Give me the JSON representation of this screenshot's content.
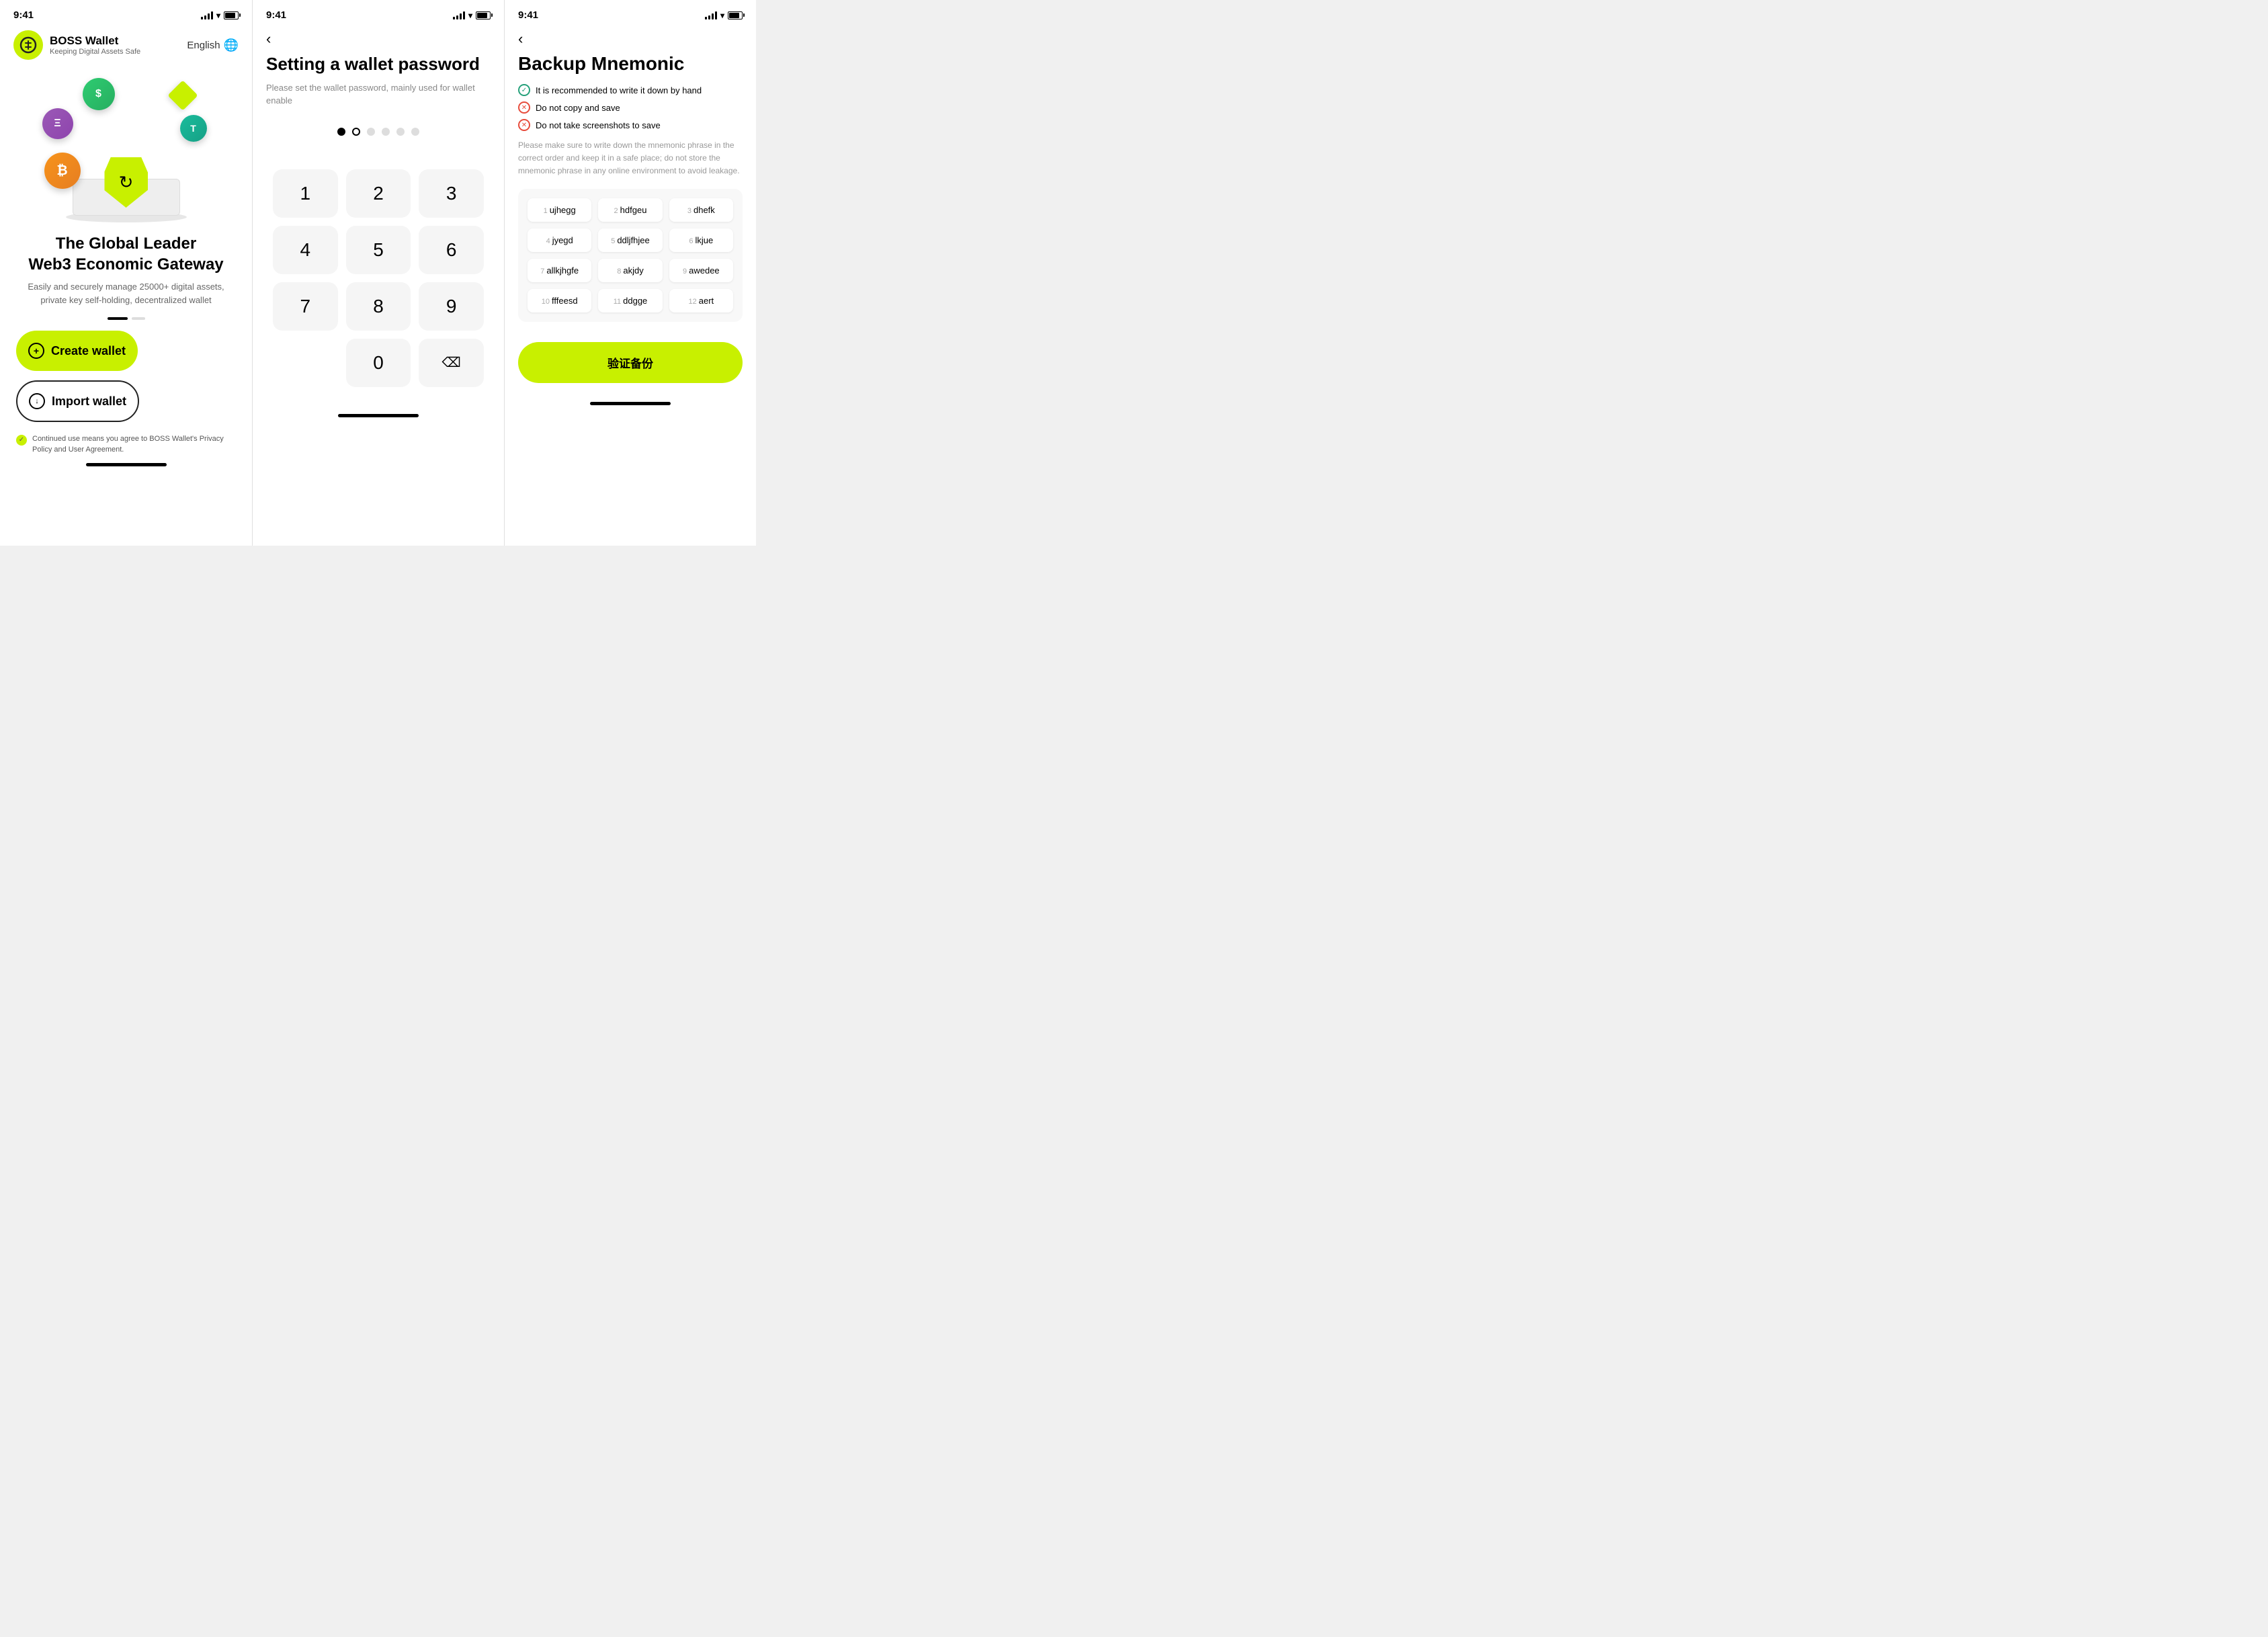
{
  "phone1": {
    "status_time": "9:41",
    "logo_emoji": "◎",
    "logo_name": "BOSS Wallet",
    "logo_tagline": "Keeping Digital Assets Safe",
    "language": "English",
    "hero_title_line1": "The Global Leader",
    "hero_title_line2": "Web3 Economic Gateway",
    "hero_subtitle": "Easily and securely manage 25000+ digital assets, private key self-holding, decentralized wallet",
    "create_label": "Create wallet",
    "import_label": "Import wallet",
    "privacy_text": "Continued use means you agree to BOSS Wallet's Privacy Policy and User Agreement."
  },
  "phone2": {
    "status_time": "9:41",
    "title": "Setting a wallet password",
    "subtitle": "Please set the wallet password, mainly used for wallet enable",
    "keys": [
      "1",
      "2",
      "3",
      "4",
      "5",
      "6",
      "7",
      "8",
      "9",
      "",
      "0",
      "⌫"
    ]
  },
  "phone3": {
    "status_time": "9:41",
    "title": "Backup Mnemonic",
    "tip1": "It is recommended to write it down by hand",
    "tip2": "Do not copy and save",
    "tip3": "Do not take screenshots to save",
    "desc": "Please make sure to write down the mnemonic phrase in the correct order and keep it in a safe place; do not store the mnemonic phrase in any online environment to avoid leakage.",
    "words": [
      {
        "num": 1,
        "word": "ujhegg"
      },
      {
        "num": 2,
        "word": "hdfgeu"
      },
      {
        "num": 3,
        "word": "dhefk"
      },
      {
        "num": 4,
        "word": "jyegd"
      },
      {
        "num": 5,
        "word": "ddljfhjee"
      },
      {
        "num": 6,
        "word": "lkjue"
      },
      {
        "num": 7,
        "word": "allkjhgfe"
      },
      {
        "num": 8,
        "word": "akjdy"
      },
      {
        "num": 9,
        "word": "awedee"
      },
      {
        "num": 10,
        "word": "fffeesd"
      },
      {
        "num": 11,
        "word": "ddgge"
      },
      {
        "num": 12,
        "word": "aert"
      }
    ],
    "verify_btn": "验证备份"
  }
}
